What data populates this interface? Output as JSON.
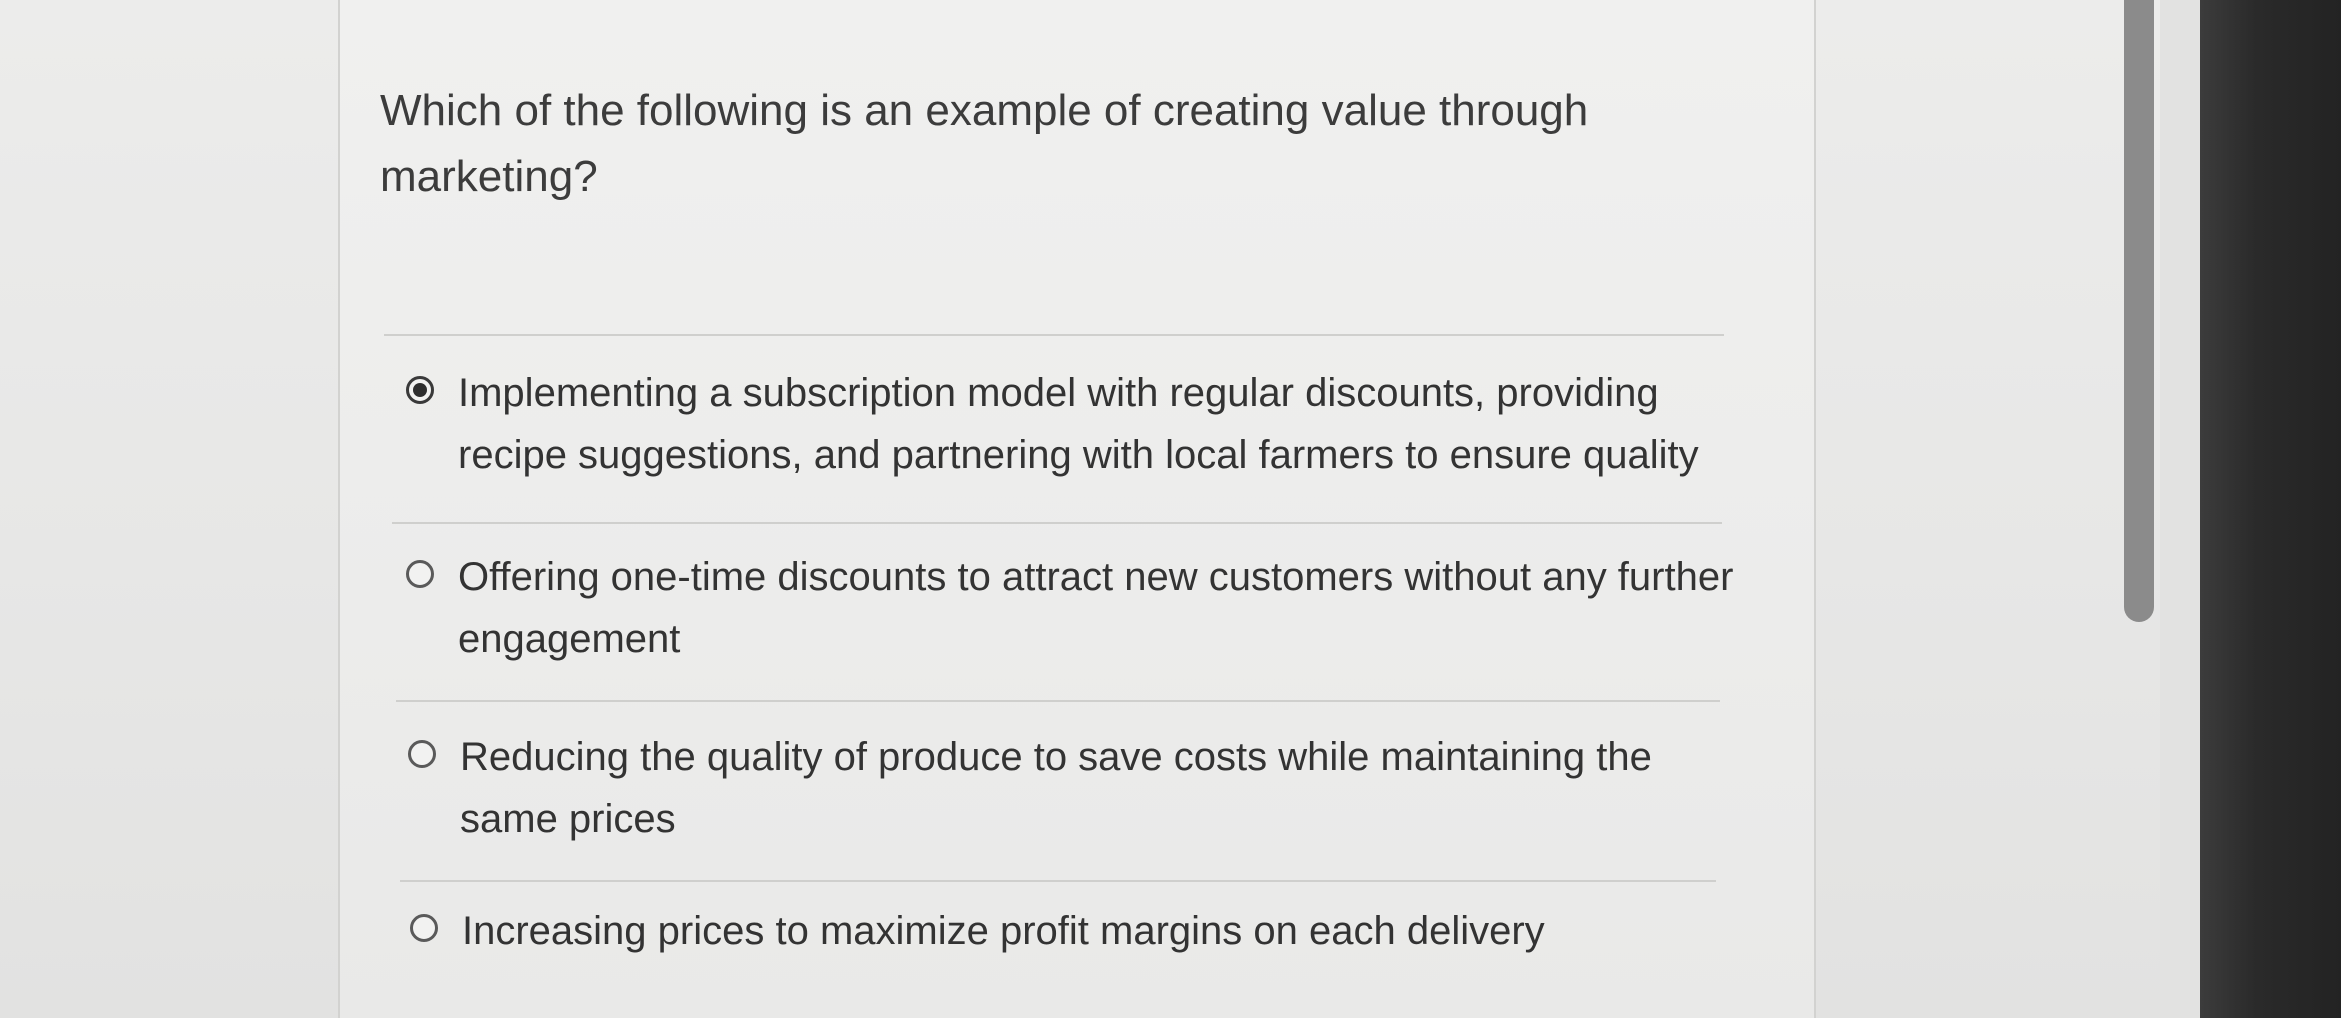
{
  "question": {
    "text": "Which of the following is an example of creating value through marketing?"
  },
  "options": [
    {
      "label": "Implementing a subscription model with regular discounts, providing recipe suggestions, and partnering with local farmers to ensure quality",
      "selected": true
    },
    {
      "label": "Offering one-time discounts to attract new customers without any further engagement",
      "selected": false
    },
    {
      "label": "Reducing the quality of produce to save costs while maintaining the same prices",
      "selected": false
    },
    {
      "label": "Increasing prices to maximize profit margins on each delivery",
      "selected": false
    }
  ],
  "colors": {
    "background": "#ececeb",
    "text": "#333333",
    "scrollbar_thumb": "#8b8b8b",
    "bezel": "#2a2a2a"
  },
  "scrollbar": {
    "position": 0
  }
}
